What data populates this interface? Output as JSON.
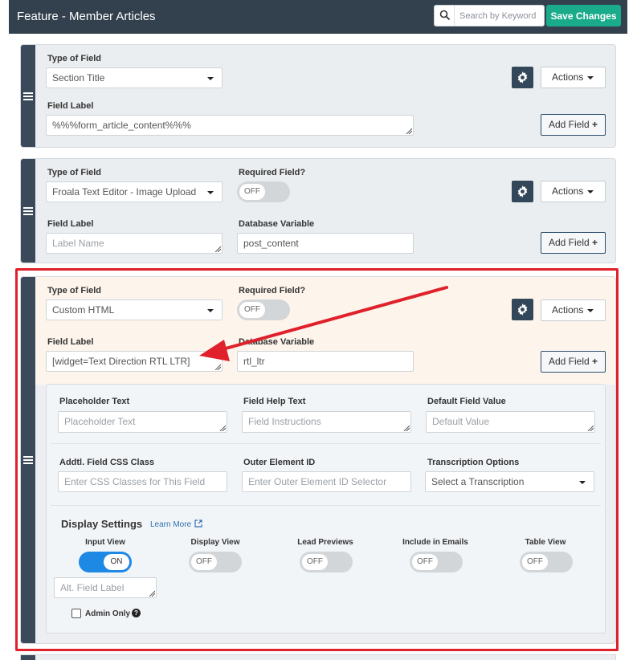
{
  "header": {
    "title": "Feature - Member Articles",
    "search_placeholder": "Search by Keyword",
    "save_label": "Save Changes"
  },
  "common": {
    "actions_label": "Actions",
    "add_field_label": "Add Field",
    "add_field_plus": "+",
    "type_of_field_label": "Type of Field",
    "field_label_label": "Field Label",
    "required_label": "Required Field?",
    "db_var_label": "Database Variable",
    "off": "OFF",
    "on": "ON"
  },
  "card1": {
    "type_value": "Section Title",
    "field_label_value": "%%%form_article_content%%%"
  },
  "card2": {
    "type_value": "Froala Text Editor - Image Upload",
    "field_label_placeholder": "Label Name",
    "db_var_value": "post_content"
  },
  "card3": {
    "type_value": "Custom HTML",
    "field_label_value": "[widget=Text Direction RTL LTR]",
    "db_var_value": "rtl_ltr",
    "advanced": {
      "placeholder_text_label": "Placeholder Text",
      "placeholder_text_placeholder": "Placeholder Text",
      "help_text_label": "Field Help Text",
      "help_text_placeholder": "Field Instructions",
      "default_value_label": "Default Field Value",
      "default_value_placeholder": "Default Value",
      "css_class_label": "Addtl. Field CSS Class",
      "css_class_placeholder": "Enter CSS Classes for This Field",
      "outer_id_label": "Outer Element ID",
      "outer_id_placeholder": "Enter Outer Element ID Selector",
      "transcription_label": "Transcription Options",
      "transcription_value": "Select a Transcription"
    },
    "display": {
      "title": "Display Settings",
      "learn_more": "Learn More",
      "toggles": [
        {
          "label": "Input View",
          "state": "ON"
        },
        {
          "label": "Display View",
          "state": "OFF"
        },
        {
          "label": "Lead Previews",
          "state": "OFF"
        },
        {
          "label": "Include in Emails",
          "state": "OFF"
        },
        {
          "label": "Table View",
          "state": "OFF"
        }
      ],
      "alt_label_placeholder": "Alt. Field Label",
      "admin_only_label": "Admin Only"
    }
  },
  "colors": {
    "header_bg": "#33414e",
    "save_green": "#1aab8b",
    "highlight_red": "#e0202a",
    "toggle_on_blue": "#1e88e5"
  }
}
